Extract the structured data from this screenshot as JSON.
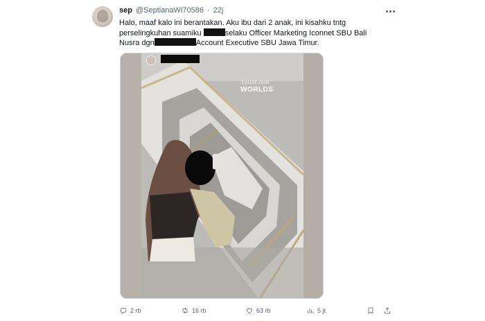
{
  "tweet": {
    "author_name": "sep",
    "handle": "@SeptianaWi70586",
    "separator": "·",
    "time": "22j",
    "text": {
      "line1": "Halo, maaf kalo ini berantakan. Aku ibu dari 2 anak, ini kisahku tntg",
      "line2_a": "perselingkuhan suamiku",
      "line2_b": "selaku Officer Marketing Iconnet SBU Bali",
      "line3_a": "Nusra dgn",
      "line3_b": "Account Executive SBU Jawa Timur."
    },
    "media": {
      "caption_small": "'CAUSE OUR",
      "caption_big": "WORLDS"
    },
    "actions": {
      "replies": "2 rb",
      "retweets": "16 rb",
      "likes": "63 rb",
      "views": "5 jt"
    },
    "icons": [
      "more-icon",
      "reply-icon",
      "retweet-icon",
      "like-icon",
      "views-icon",
      "bookmark-icon",
      "share-icon"
    ]
  }
}
